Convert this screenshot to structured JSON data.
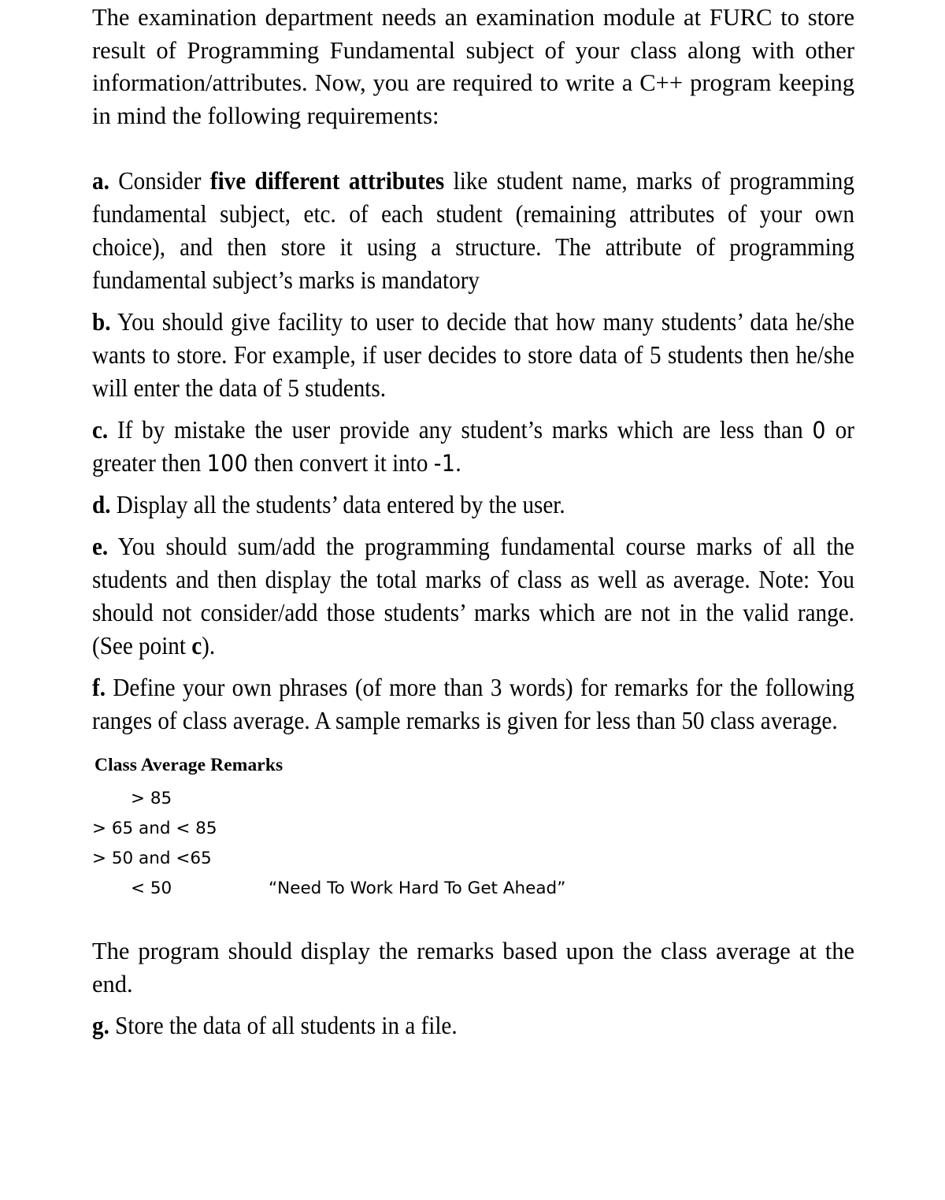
{
  "document": {
    "intro": {
      "text": "The examination department needs an examination module at FURC to store result of Programming Fundamental subject of your class along with other information/attributes. Now, you are required to write a C++ program keeping in mind the following requirements:"
    },
    "items": [
      {
        "marker": "a.",
        "text_before_bold": " Consider ",
        "bold": "five different attributes",
        "text_after_bold": " like student name, marks of programming fundamental subject, etc. of each student (remaining attributes of your own choice), and then store it using a structure. The attribute of programming fundamental subject’s marks is mandatory"
      },
      {
        "marker": "b.",
        "text": " You should give facility to user to decide that how many students’ data he/she wants to store. For example, if user decides to store data of 5 students then he/she will enter the data of 5 students."
      },
      {
        "marker": "c.",
        "part1": " If by mistake the user provide any student’s marks which are less than ",
        "num1": "0",
        "part2": " or greater then ",
        "num2": "100",
        "part3": " then convert it into ",
        "num3": "-1",
        "part4": "."
      },
      {
        "marker": "d.",
        "text": " Display all the students’ data entered by the user."
      },
      {
        "marker": "e.",
        "text_before_bold": " You should sum/add the programming fundamental course marks of all the students and then display the total marks of class as well as average. Note: You should not consider/add those students’ marks which are not in the valid range. (See point ",
        "bold": "c",
        "text_after_bold": ")."
      },
      {
        "marker": "f.",
        "text": " Define your own phrases (of more than 3 words) for remarks for the following ranges of class average. A sample remarks is given for less than 50 class average."
      }
    ],
    "remarks_table": {
      "header": "Class Average Remarks",
      "rows": [
        {
          "range": "> 85",
          "remark": "",
          "indent": true
        },
        {
          "range": "> 65 and < 85",
          "remark": "",
          "indent": false
        },
        {
          "range": "> 50 and <65",
          "remark": "",
          "indent": false
        },
        {
          "range": "< 50",
          "remark": "“Need To Work Hard To Get Ahead”",
          "indent": true
        }
      ]
    },
    "closing": {
      "text": "The program should display the remarks based upon the class average at the end."
    },
    "final_item": {
      "marker": "g.",
      "text": " Store the data of all students in a file."
    }
  }
}
